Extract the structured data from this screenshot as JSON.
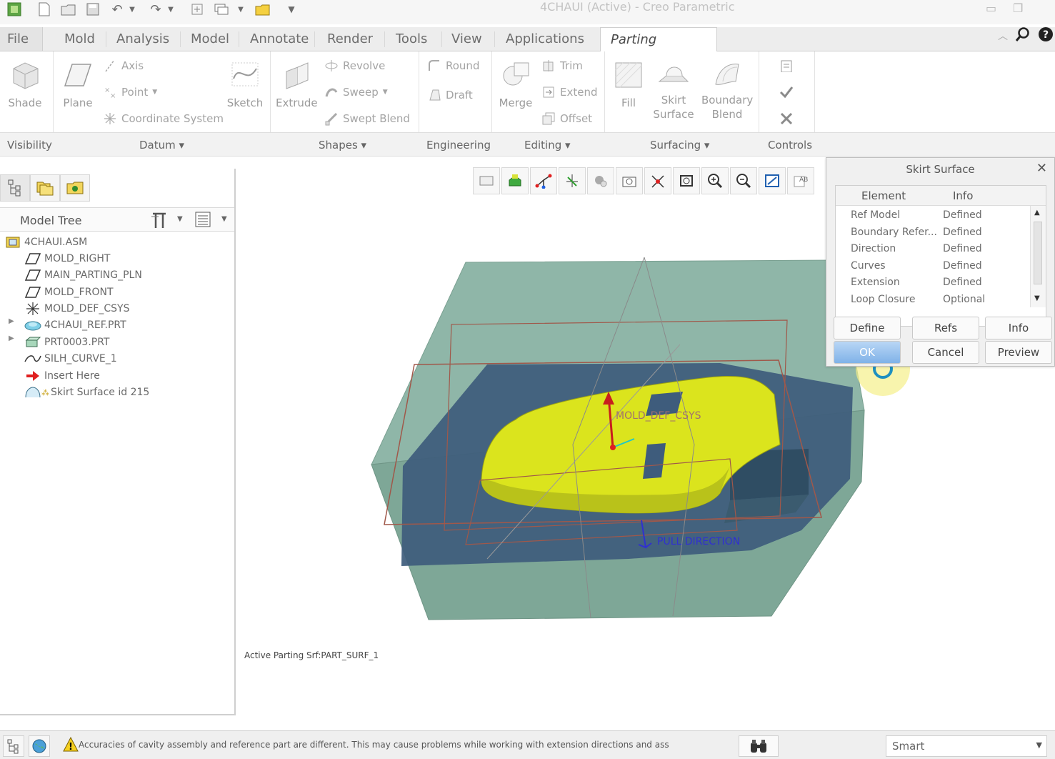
{
  "window": {
    "title": "4CHAUI (Active) - Creo Parametric"
  },
  "tabs": [
    {
      "label": "File ▾"
    },
    {
      "label": "Mold"
    },
    {
      "label": "Analysis"
    },
    {
      "label": "Model"
    },
    {
      "label": "Annotate"
    },
    {
      "label": "Render"
    },
    {
      "label": "Tools"
    },
    {
      "label": "View"
    },
    {
      "label": "Applications"
    },
    {
      "label": "Parting Surface"
    }
  ],
  "ribbon": {
    "shade": "Shade",
    "plane": "Plane",
    "axis": "Axis",
    "point": "Point",
    "csys": "Coordinate System",
    "sketch": "Sketch",
    "extrude": "Extrude",
    "revolve": "Revolve",
    "sweep": "Sweep",
    "swept_blend": "Swept Blend",
    "round": "Round",
    "draft": "Draft",
    "merge": "Merge",
    "trim": "Trim",
    "extend": "Extend",
    "offset": "Offset",
    "fill": "Fill",
    "skirt_surface_line1": "Skirt",
    "skirt_surface_line2": "Surface",
    "boundary_blend_line1": "Boundary",
    "boundary_blend_line2": "Blend",
    "groups": {
      "visibility": "Visibility",
      "datum": "Datum ▾",
      "shapes": "Shapes ▾",
      "engineering": "Engineering",
      "editing": "Editing ▾",
      "surfacing": "Surfacing ▾",
      "controls": "Controls"
    }
  },
  "model_tree": {
    "title": "Model Tree",
    "items": [
      {
        "label": "4CHAUI.ASM"
      },
      {
        "label": "MOLD_RIGHT"
      },
      {
        "label": "MAIN_PARTING_PLN"
      },
      {
        "label": "MOLD_FRONT"
      },
      {
        "label": "MOLD_DEF_CSYS"
      },
      {
        "label": "4CHAUI_REF.PRT"
      },
      {
        "label": "PRT0003.PRT"
      },
      {
        "label": "SILH_CURVE_1"
      },
      {
        "label": "Insert Here"
      },
      {
        "label": "Skirt Surface id 215"
      }
    ]
  },
  "viewport": {
    "active_parting_srf": "Active Parting Srf:PART_SURF_1",
    "csys_label": "MOLD_DEF_CSYS",
    "pull_direction_label": "PULL DIRECTION",
    "colors": {
      "mold_box": "#7fa89a",
      "part": "#d9e21c",
      "parting_plane": "#3f5a78",
      "datum_lines": "#a0584a"
    }
  },
  "dialog": {
    "title": "Skirt Surface",
    "col_element": "Element",
    "col_info": "Info",
    "rows": [
      {
        "element": "Ref Model",
        "info": "Defined"
      },
      {
        "element": "Boundary Refer...",
        "info": "Defined"
      },
      {
        "element": "Direction",
        "info": "Defined"
      },
      {
        "element": "Curves",
        "info": "Defined"
      },
      {
        "element": "Extension",
        "info": "Defined"
      },
      {
        "element": "Loop Closure",
        "info": "Optional"
      }
    ],
    "buttons": {
      "define": "Define",
      "refs": "Refs",
      "info": "Info",
      "ok": "OK",
      "cancel": "Cancel",
      "preview": "Preview"
    }
  },
  "statusbar": {
    "message": "Accuracies of cavity assembly and reference part are different. This may  cause problems while working with extension directions and ass",
    "filter": "Smart"
  }
}
